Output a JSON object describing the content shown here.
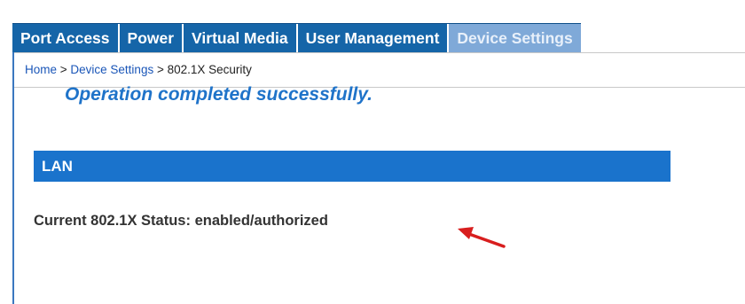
{
  "tabs": [
    {
      "label": "Port Access",
      "active": false
    },
    {
      "label": "Power",
      "active": false
    },
    {
      "label": "Virtual Media",
      "active": false
    },
    {
      "label": "User Management",
      "active": false
    },
    {
      "label": "Device Settings",
      "active": true
    }
  ],
  "breadcrumb": {
    "home": "Home",
    "separator1": " > ",
    "device_settings": "Device Settings",
    "separator2": " > ",
    "current": "802.1X Security"
  },
  "message": "Operation completed successfully.",
  "section": {
    "title": "LAN",
    "status_label": "Current 802.1X Status:",
    "status_value": "enabled/authorized"
  },
  "colors": {
    "tab_bar": "#1565a8",
    "active_tab": "#7fa9d8",
    "section_header": "#1a73cc",
    "message": "#1f73c9",
    "arrow": "#d81e1e"
  },
  "icons": {
    "status_arrow": "red-arrow-icon"
  }
}
